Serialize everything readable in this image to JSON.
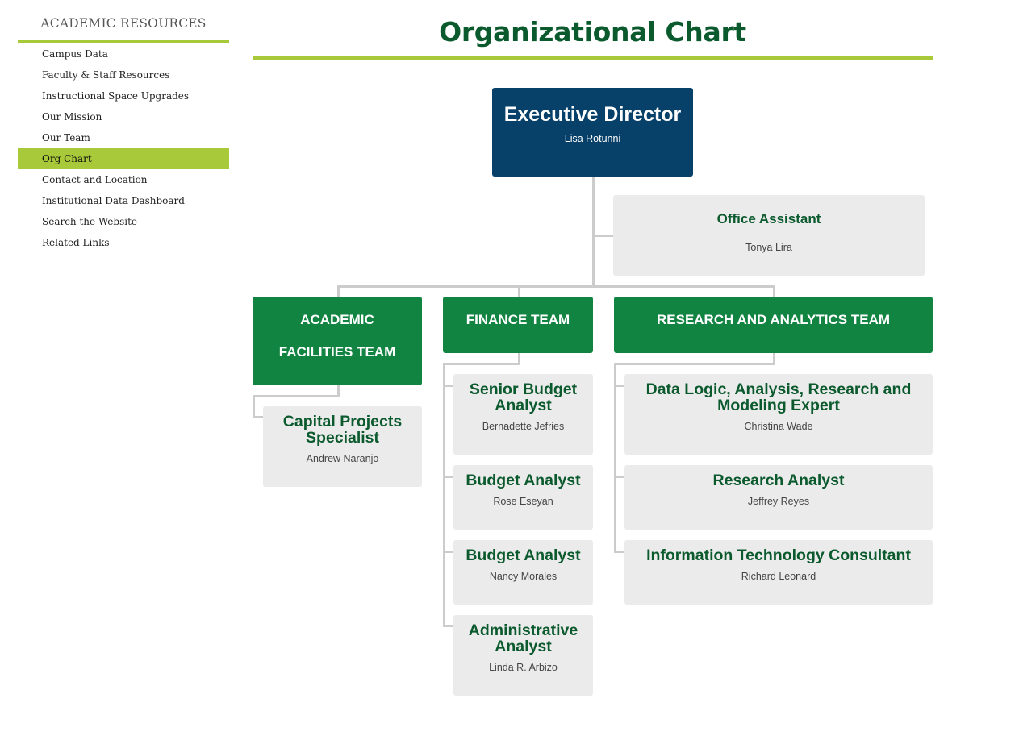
{
  "sidebar": {
    "heading": "ACADEMIC RESOURCES",
    "items": [
      {
        "label": "Campus Data",
        "active": false
      },
      {
        "label": "Faculty & Staff Resources",
        "active": false
      },
      {
        "label": "Instructional Space Upgrades",
        "active": false
      },
      {
        "label": "Our Mission",
        "active": false
      },
      {
        "label": "Our Team",
        "active": false
      },
      {
        "label": "Org Chart",
        "active": true
      },
      {
        "label": "Contact and Location",
        "active": false
      },
      {
        "label": "Institutional Data Dashboard",
        "active": false
      },
      {
        "label": "Search the Website",
        "active": false
      },
      {
        "label": "Related Links",
        "active": false
      }
    ]
  },
  "page": {
    "title": "Organizational Chart"
  },
  "colors": {
    "accent": "#a8c93a",
    "executive": "#074068",
    "team": "#128442",
    "staff_bg": "#ebebeb",
    "staff_title": "#0b5a2e",
    "connector": "#cccccc"
  },
  "org": {
    "executive": {
      "title": "Executive Director",
      "name": "Lisa Rotunni"
    },
    "office_assistant": {
      "title": "Office Assistant",
      "name": "Tonya Lira"
    },
    "teams": [
      {
        "name": "ACADEMIC FACILITIES TEAM",
        "name_line1": "ACADEMIC",
        "name_line2": "FACILITIES TEAM",
        "members": [
          {
            "title": "Capital Projects Specialist",
            "name": "Andrew Naranjo"
          }
        ]
      },
      {
        "name": "FINANCE TEAM",
        "members": [
          {
            "title": "Senior Budget Analyst",
            "name": "Bernadette Jefries"
          },
          {
            "title": "Budget Analyst",
            "name": "Rose Eseyan"
          },
          {
            "title": "Budget Analyst",
            "name": "Nancy Morales"
          },
          {
            "title": "Administrative Analyst",
            "name": "Linda R. Arbizo"
          }
        ]
      },
      {
        "name": "RESEARCH AND ANALYTICS TEAM",
        "members": [
          {
            "title": "Data Logic, Analysis, Research and Modeling Expert",
            "name": "Christina Wade"
          },
          {
            "title": "Research Analyst",
            "name": "Jeffrey Reyes"
          },
          {
            "title": "Information Technology Consultant",
            "name": "Richard Leonard"
          }
        ]
      }
    ]
  }
}
